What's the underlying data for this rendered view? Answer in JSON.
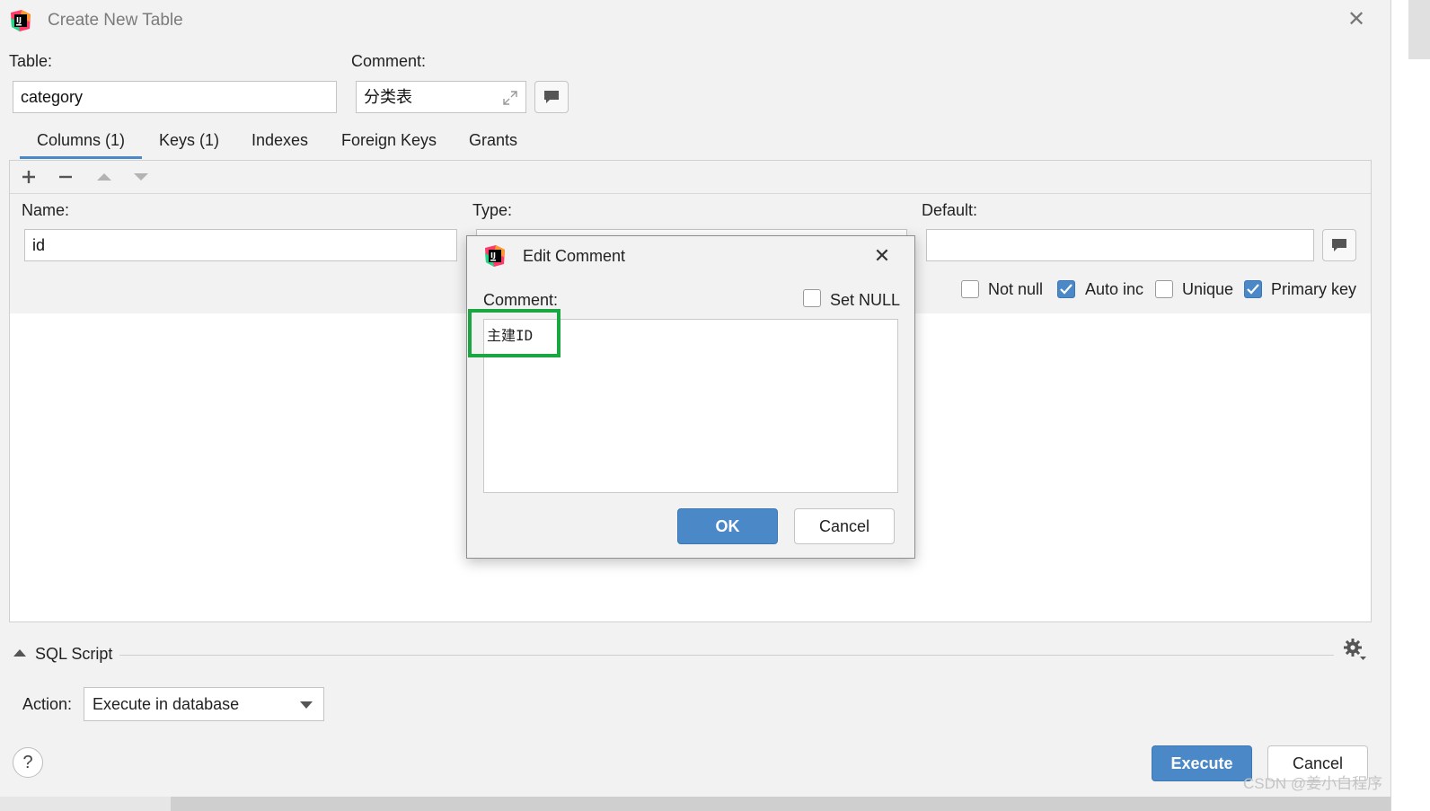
{
  "window": {
    "title": "Create New Table",
    "close_icon": "close-icon"
  },
  "table": {
    "label": "Table:",
    "value": "category"
  },
  "comment": {
    "label": "Comment:",
    "value": "分类表"
  },
  "tabs": [
    {
      "label": "Columns (1)",
      "active": true
    },
    {
      "label": "Keys (1)"
    },
    {
      "label": "Indexes"
    },
    {
      "label": "Foreign Keys"
    },
    {
      "label": "Grants"
    }
  ],
  "toolbar": {
    "icons": [
      "add-icon",
      "remove-icon",
      "move-up-icon",
      "move-down-icon"
    ]
  },
  "column_props": {
    "name_label": "Name:",
    "name_value": "id",
    "type_label": "Type:",
    "default_label": "Default:",
    "default_value": "",
    "checkboxes": [
      {
        "label": "Not null",
        "checked": false
      },
      {
        "label": "Auto inc",
        "checked": true
      },
      {
        "label": "Unique",
        "checked": false
      },
      {
        "label": "Primary key",
        "checked": true
      }
    ]
  },
  "sql_script": {
    "label": "SQL Script",
    "action_label": "Action:",
    "action_value": "Execute in database"
  },
  "footer": {
    "help": "?",
    "execute_label": "Execute",
    "cancel_label": "Cancel"
  },
  "dialog": {
    "title": "Edit Comment",
    "comment_label": "Comment:",
    "set_null_label": "Set NULL",
    "set_null_checked": false,
    "text_value": "主建ID",
    "ok_label": "OK",
    "cancel_label": "Cancel"
  },
  "watermark": "CSDN @姜小白程序",
  "colors": {
    "accent": "#4a88c7",
    "highlight": "#1aa640",
    "background": "#f2f2f2"
  }
}
